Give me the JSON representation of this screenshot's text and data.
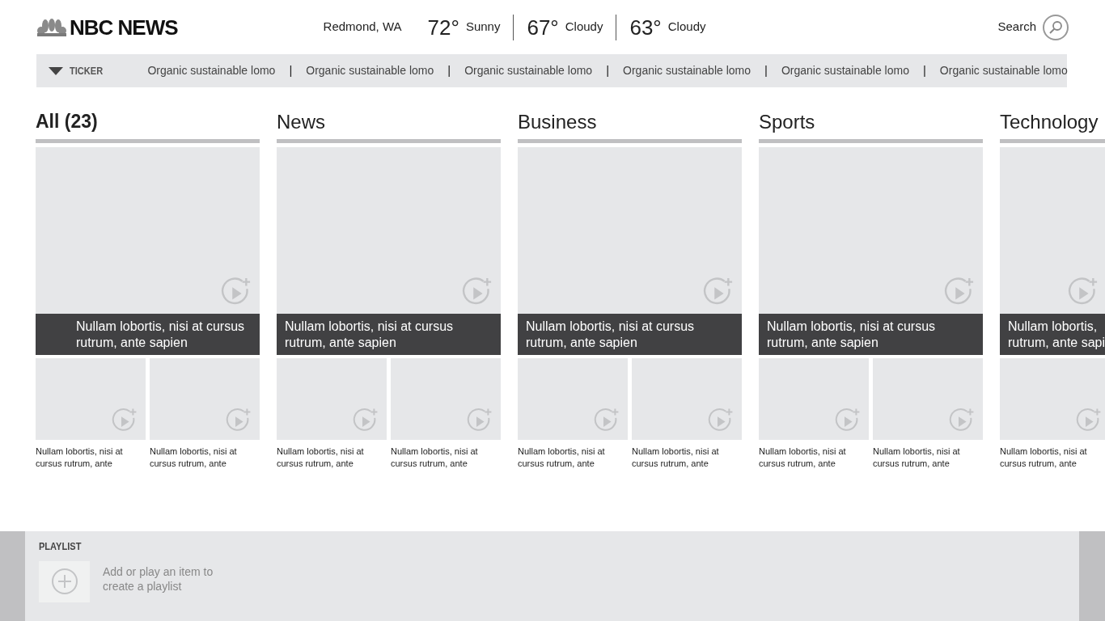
{
  "header": {
    "brand": "NBC NEWS",
    "location": "Redmond, WA",
    "forecast": [
      {
        "temp": "72°",
        "condition": "Sunny"
      },
      {
        "temp": "67°",
        "condition": "Cloudy"
      },
      {
        "temp": "63°",
        "condition": "Cloudy"
      }
    ],
    "search": {
      "label": "Search"
    }
  },
  "ticker": {
    "label": "TICKER",
    "expanded": true,
    "items": [
      {
        "kind": "headline",
        "text": "Organic sustainable lomo"
      },
      {
        "kind": "separator",
        "text": "|"
      },
      {
        "kind": "headline",
        "text": "Organic sustainable lomo"
      },
      {
        "kind": "separator",
        "text": "|"
      },
      {
        "kind": "headline",
        "text": "Organic sustainable lomo"
      },
      {
        "kind": "separator",
        "text": "|"
      },
      {
        "kind": "headline",
        "text": "Organic sustainable lomo"
      },
      {
        "kind": "separator",
        "text": "|"
      },
      {
        "kind": "headline",
        "text": "Organic sustainable lomo"
      },
      {
        "kind": "separator",
        "text": "|"
      },
      {
        "kind": "headline",
        "text": "Organic sustainable lomo"
      }
    ]
  },
  "sections": [
    {
      "heading": "All (23)",
      "selected": true,
      "feature": {
        "title_lines": [
          "Nullam lobortis, nisi at cursus",
          "rutrum, ante sapien"
        ]
      },
      "items": [
        {
          "caption_lines": [
            "Nullam lobortis, nisi at",
            "cursus rutrum, ante"
          ]
        },
        {
          "caption_lines": [
            "Nullam lobortis, nisi at",
            "cursus rutrum, ante"
          ]
        }
      ]
    },
    {
      "heading": "News",
      "selected": false,
      "feature": {
        "title_lines": [
          "Nullam lobortis, nisi at cursus",
          "rutrum, ante sapien"
        ]
      },
      "items": [
        {
          "caption_lines": [
            "Nullam lobortis, nisi at",
            "cursus rutrum, ante"
          ]
        },
        {
          "caption_lines": [
            "Nullam lobortis, nisi at",
            "cursus rutrum, ante"
          ]
        }
      ]
    },
    {
      "heading": "Business",
      "selected": false,
      "feature": {
        "title_lines": [
          "Nullam lobortis, nisi at cursus",
          "rutrum, ante sapien"
        ]
      },
      "items": [
        {
          "caption_lines": [
            "Nullam lobortis, nisi at",
            "cursus rutrum, ante"
          ]
        },
        {
          "caption_lines": [
            "Nullam lobortis, nisi at",
            "cursus rutrum, ante"
          ]
        }
      ]
    },
    {
      "heading": "Sports",
      "selected": false,
      "feature": {
        "title_lines": [
          "Nullam lobortis, nisi at cursus",
          "rutrum, ante sapien"
        ]
      },
      "items": [
        {
          "caption_lines": [
            "Nullam lobortis, nisi at",
            "cursus rutrum, ante"
          ]
        },
        {
          "caption_lines": [
            "Nullam lobortis, nisi at",
            "cursus rutrum, ante"
          ]
        }
      ]
    },
    {
      "heading": "Technology",
      "selected": false,
      "feature": {
        "title_lines": [
          "Nullam lobortis,",
          "rutrum, ante sapi"
        ]
      },
      "items": [
        {
          "caption_lines": [
            "Nullam lobortis, nisi at",
            "cursus rutrum, ante"
          ]
        }
      ]
    }
  ],
  "playlist": {
    "title": "PLAYLIST",
    "hint_lines": [
      "Add or play an item to",
      "create a playlist"
    ]
  }
}
